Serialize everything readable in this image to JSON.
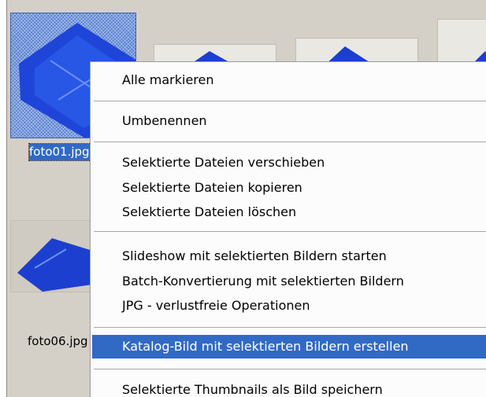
{
  "thumbnails": [
    {
      "caption": "foto01.jpg",
      "selected": true
    },
    {
      "caption": "foto06.jpg",
      "selected": false
    }
  ],
  "context_menu": {
    "items": [
      {
        "label": "Alle markieren"
      },
      {
        "label": "Umbenennen"
      },
      {
        "label": "Selektierte Dateien verschieben"
      },
      {
        "label": "Selektierte Dateien kopieren"
      },
      {
        "label": "Selektierte Dateien löschen"
      },
      {
        "label": "Slideshow mit selektierten Bildern starten"
      },
      {
        "label": "Batch-Konvertierung mit selektierten Bildern"
      },
      {
        "label": "JPG - verlustfreie Operationen"
      },
      {
        "label": "Katalog-Bild mit selektierten Bildern erstellen",
        "highlighted": true
      },
      {
        "label": "Selektierte Thumbnails als Bild speichern"
      }
    ]
  },
  "colors": {
    "highlight": "#316ac5",
    "pane_background": "#d4d0c8",
    "photo_blue": "#1d3fcf"
  }
}
